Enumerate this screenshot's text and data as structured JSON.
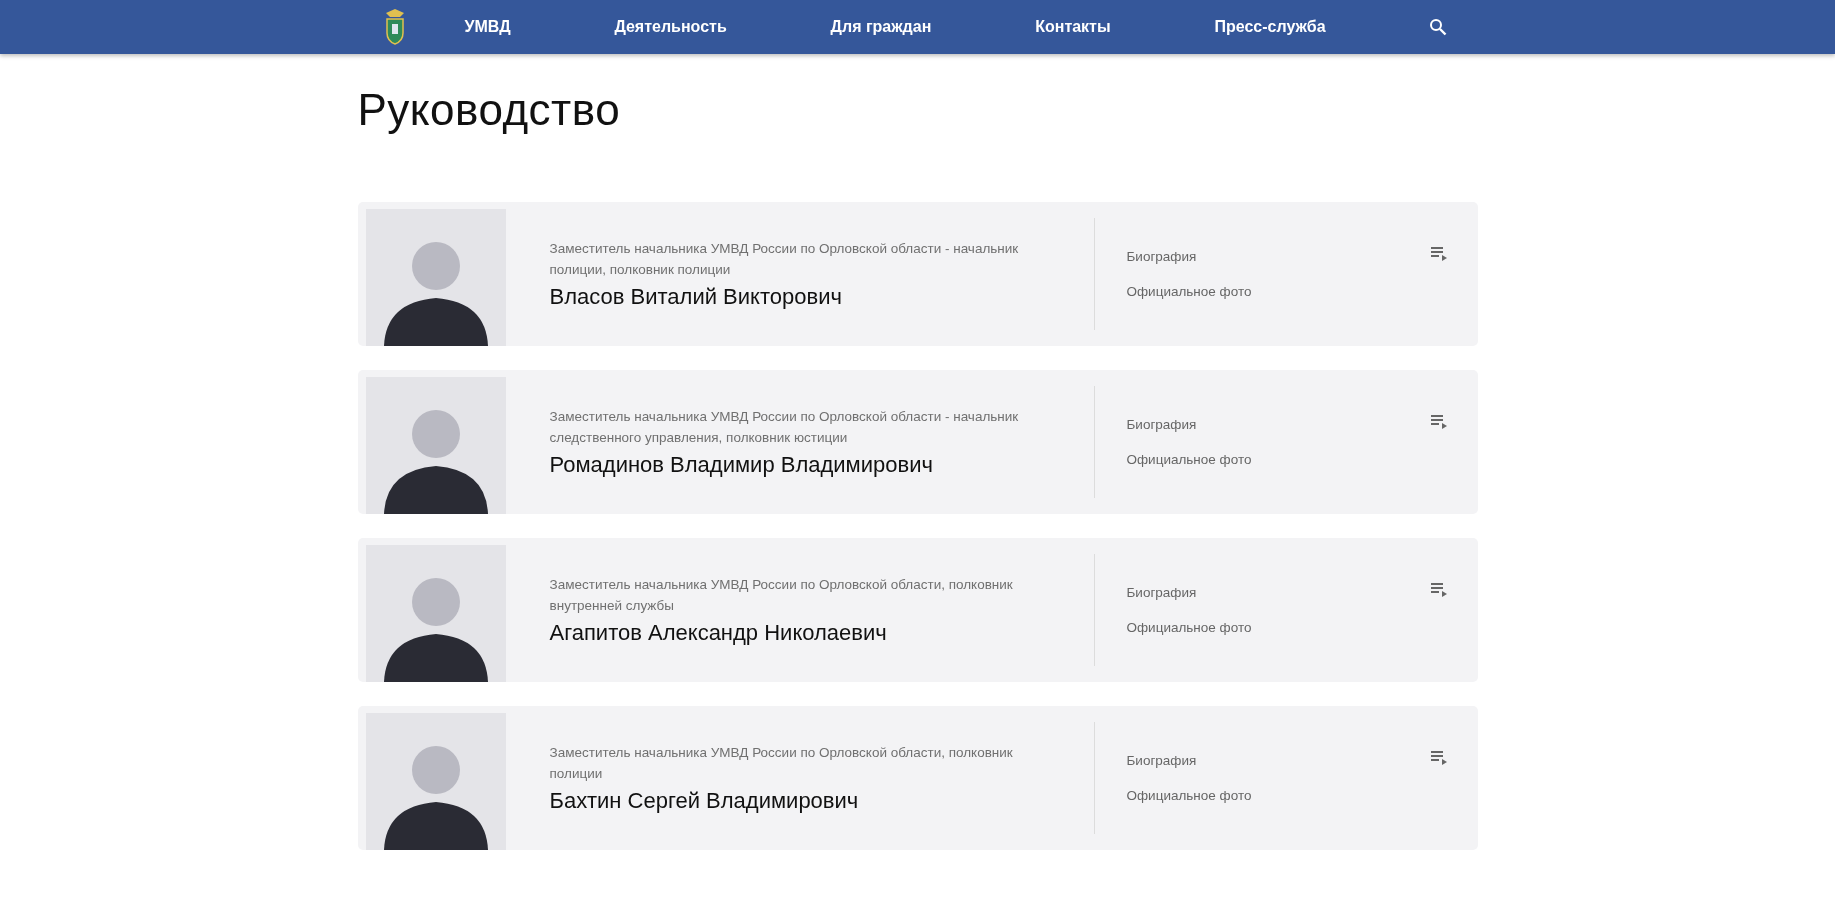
{
  "nav": {
    "items": [
      "УМВД",
      "Деятельность",
      "Для граждан",
      "Контакты",
      "Пресс-служба"
    ]
  },
  "page": {
    "title": "Руководство"
  },
  "leaders": [
    {
      "position": "Заместитель начальника УМВД России по Орловской области - начальник полиции, полковник полиции",
      "name": "Власов Виталий Викторович",
      "links": [
        "Биография",
        "Официальное фото"
      ]
    },
    {
      "position": "Заместитель начальника УМВД России по Орловской области - начальник следственного управления, полковник юстиции",
      "name": "Ромадинов Владимир Владимирович",
      "links": [
        "Биография",
        "Официальное фото"
      ]
    },
    {
      "position": "Заместитель начальника УМВД России по Орловской области, полковник внутренней службы",
      "name": "Агапитов Александр Николаевич",
      "links": [
        "Биография",
        "Официальное фото"
      ]
    },
    {
      "position": "Заместитель начальника УМВД России по Орловской области, полковник полиции",
      "name": "Бахтин Сергей Владимирович",
      "links": [
        "Биография",
        "Официальное фото"
      ]
    }
  ]
}
